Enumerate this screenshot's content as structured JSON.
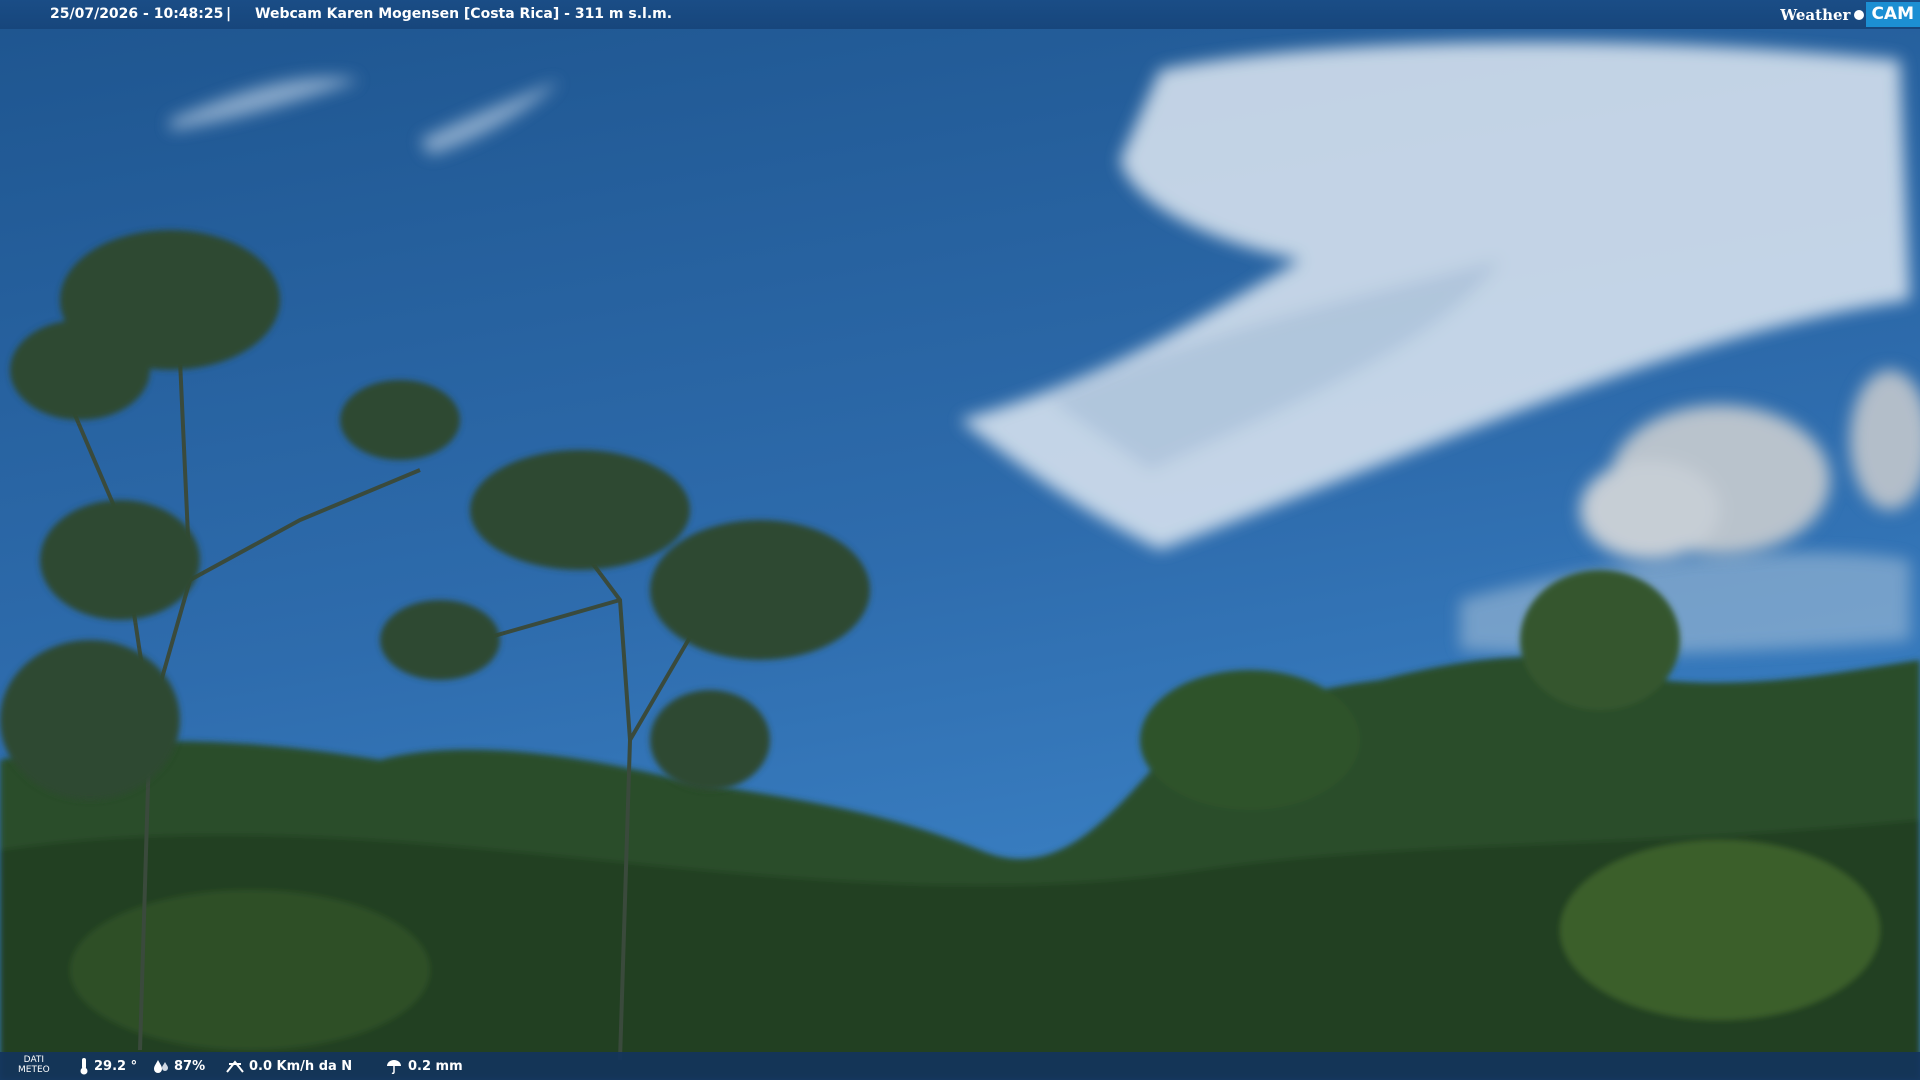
{
  "overlay": {
    "timestamp": "25/07/2026 - 10:48:25",
    "separator": "|",
    "title": "Webcam Karen Mogensen [Costa Rica]  - 311 m s.l.m.",
    "brand_weather": "Weather",
    "brand_cam": "CAM"
  },
  "meteo": {
    "label_line1": "DATI",
    "label_line2": "METEO",
    "temperature": "29.2 °",
    "humidity": "87%",
    "wind": "0.0 Km/h da N",
    "rain": "0.2 mm"
  },
  "icons": [
    "thermometer-icon",
    "humidity-drops-icon",
    "wind-icon",
    "rain-icon"
  ],
  "colors": {
    "bar": "#17467c",
    "cam_badge": "#1c8fd3",
    "sky": "#2f6fb0"
  }
}
